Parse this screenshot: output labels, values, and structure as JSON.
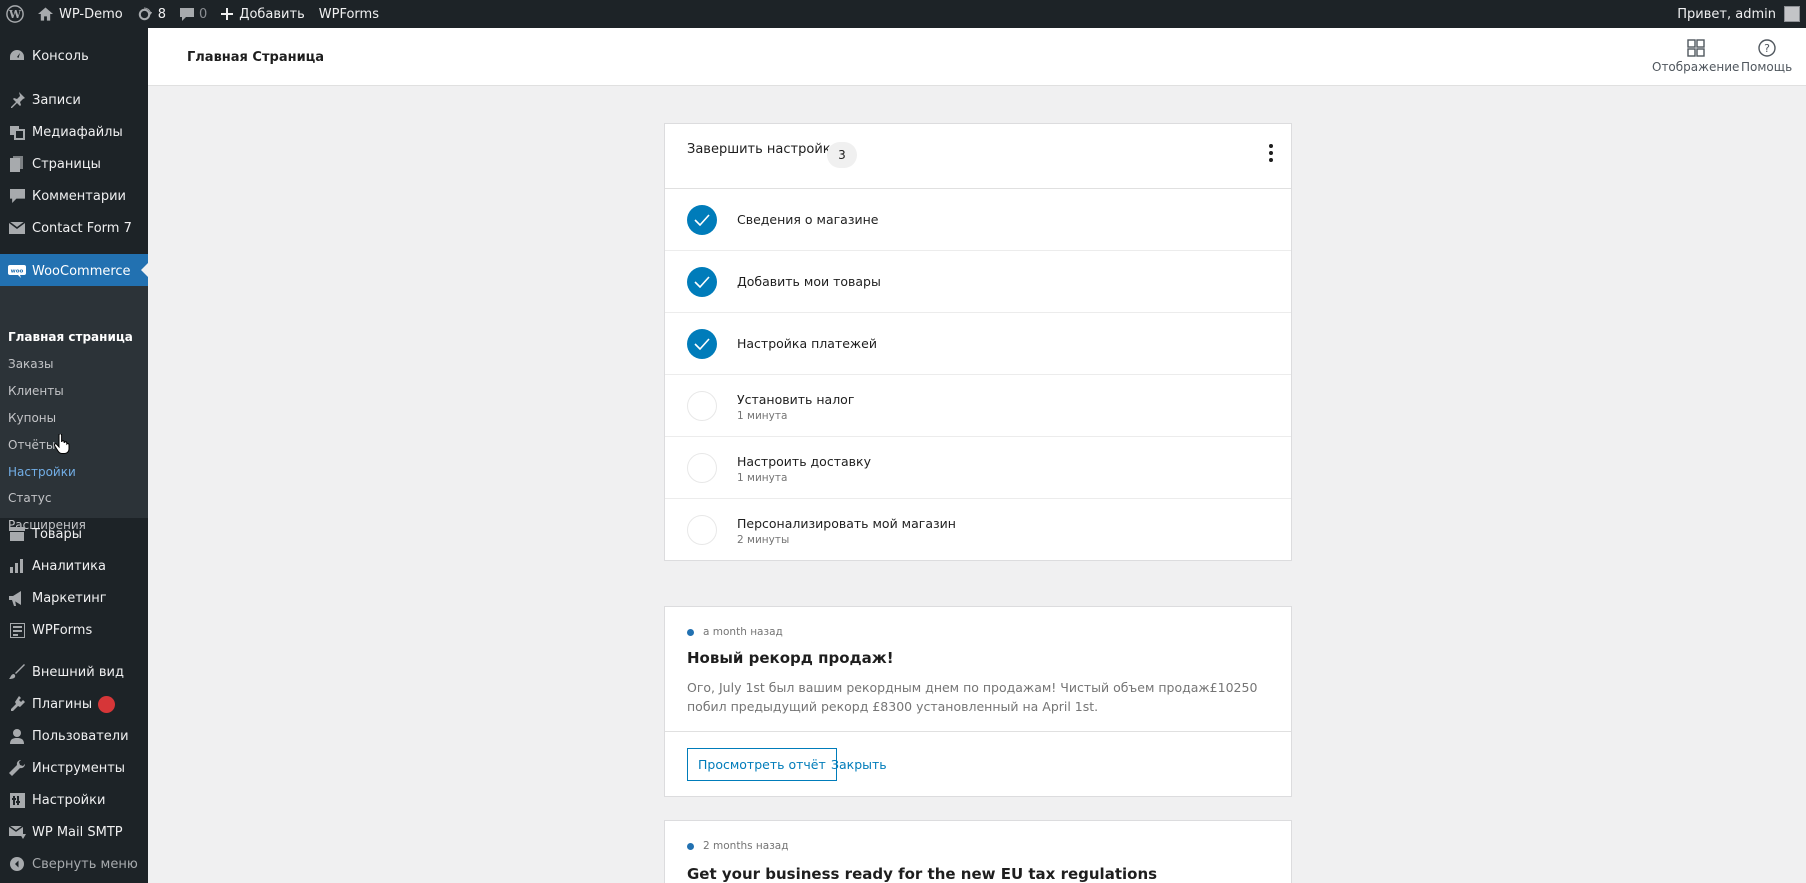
{
  "adminbar": {
    "site_name": "WP-Demo",
    "updates_count": "8",
    "comments_count": "0",
    "add_label": "Добавить",
    "wpforms_label": "WPForms",
    "greeting": "Привет, admin"
  },
  "sidebar": {
    "items": [
      {
        "label": "Консоль",
        "icon": "dashboard-icon"
      },
      {
        "label": "Записи",
        "icon": "pin-icon"
      },
      {
        "label": "Медиафайлы",
        "icon": "media-icon"
      },
      {
        "label": "Страницы",
        "icon": "pages-icon"
      },
      {
        "label": "Комментарии",
        "icon": "comments-icon"
      },
      {
        "label": "Contact Form 7",
        "icon": "mail-icon"
      },
      {
        "label": "WooCommerce",
        "icon": "woo-icon"
      },
      {
        "label": "Товары",
        "icon": "archive-icon"
      },
      {
        "label": "Аналитика",
        "icon": "chart-icon"
      },
      {
        "label": "Маркетинг",
        "icon": "megaphone-icon"
      },
      {
        "label": "WPForms",
        "icon": "form-icon"
      },
      {
        "label": "Внешний вид",
        "icon": "brush-icon"
      },
      {
        "label": "Плагины",
        "icon": "plugin-icon"
      },
      {
        "label": "Пользователи",
        "icon": "users-icon"
      },
      {
        "label": "Инструменты",
        "icon": "wrench-icon"
      },
      {
        "label": "Настройки",
        "icon": "settings-icon"
      },
      {
        "label": "WP Mail SMTP",
        "icon": "mail-smtp-icon"
      }
    ],
    "submenu": [
      "Главная страница",
      "Заказы",
      "Клиенты",
      "Купоны",
      "Отчёты",
      "Настройки",
      "Статус",
      "Расширения"
    ],
    "collapse_label": "Свернуть меню"
  },
  "header": {
    "title": "Главная Страница",
    "display_label": "Отображение",
    "help_label": "Помощь"
  },
  "setup": {
    "title": "Завершить настройку",
    "count": "3",
    "tasks": [
      {
        "title": "Сведения о магазине",
        "time": "",
        "done": true
      },
      {
        "title": "Добавить мои товары",
        "time": "",
        "done": true
      },
      {
        "title": "Настройка платежей",
        "time": "",
        "done": true
      },
      {
        "title": "Установить налог",
        "time": "1 минута",
        "done": false
      },
      {
        "title": "Настроить доставку",
        "time": "1 минута",
        "done": false
      },
      {
        "title": "Персонализировать мой магазин",
        "time": "2 минуты",
        "done": false
      }
    ]
  },
  "notes": [
    {
      "time": "a month назад",
      "title": "Новый рекорд продаж!",
      "body": "Ого, July 1st был вашим рекордным днем по продажам! Чистый объем продаж£10250 побил предыдущий рекорд £8300 установленный на April 1st.",
      "primary_action": "Просмотреть отчёт",
      "secondary_action": "Закрыть"
    },
    {
      "time": "2 months назад",
      "title": "Get your business ready for the new EU tax regulations"
    }
  ],
  "colors": {
    "admin_bg": "#1d2327",
    "accent": "#2271b1",
    "check": "#007cba",
    "badge": "#d63638"
  }
}
